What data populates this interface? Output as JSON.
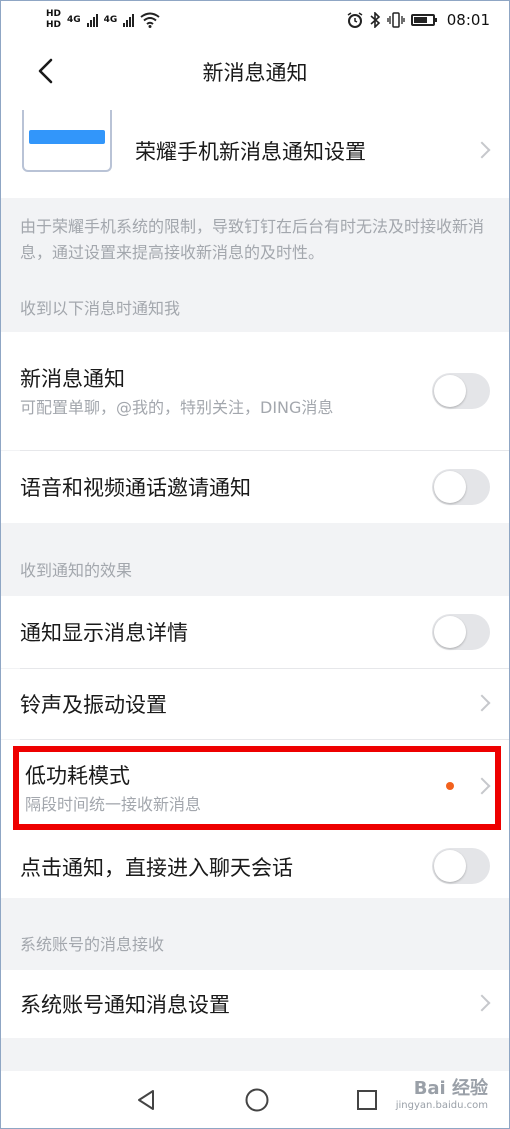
{
  "status_bar": {
    "hd1": "HD",
    "hd2": "HD",
    "net1": "4G",
    "net2": "4G",
    "time": "08:01"
  },
  "nav": {
    "title": "新消息通知"
  },
  "honor": {
    "label": "荣耀手机新消息通知设置"
  },
  "honor_note": "由于荣耀手机系统的限制，导致钉钉在后台有时无法及时接收新消息，通过设置来提高接收新消息的及时性。",
  "section1": {
    "header": "收到以下消息时通知我",
    "rows": [
      {
        "title": "新消息通知",
        "subtitle": "可配置单聊，@我的，特别关注，DING消息",
        "toggle": false
      },
      {
        "title": "语音和视频通话邀请通知",
        "toggle": false
      }
    ]
  },
  "section2": {
    "header": "收到通知的效果",
    "rows": [
      {
        "title": "通知显示消息详情",
        "toggle": false
      },
      {
        "title": "铃声及振动设置"
      },
      {
        "title": "低功耗模式",
        "subtitle": "隔段时间统一接收新消息",
        "dot_color": "#f2611d"
      },
      {
        "title": "点击通知，直接进入聊天会话",
        "toggle": false
      }
    ]
  },
  "section3": {
    "header": "系统账号的消息接收",
    "rows": [
      {
        "title": "系统账号通知消息设置"
      }
    ]
  },
  "watermark": {
    "line1": "Bai 经验",
    "line2": "jingyan.baidu.com"
  },
  "colors": {
    "accent": "#3296fa",
    "highlight": "#ee0000",
    "dot": "#f2611d"
  }
}
